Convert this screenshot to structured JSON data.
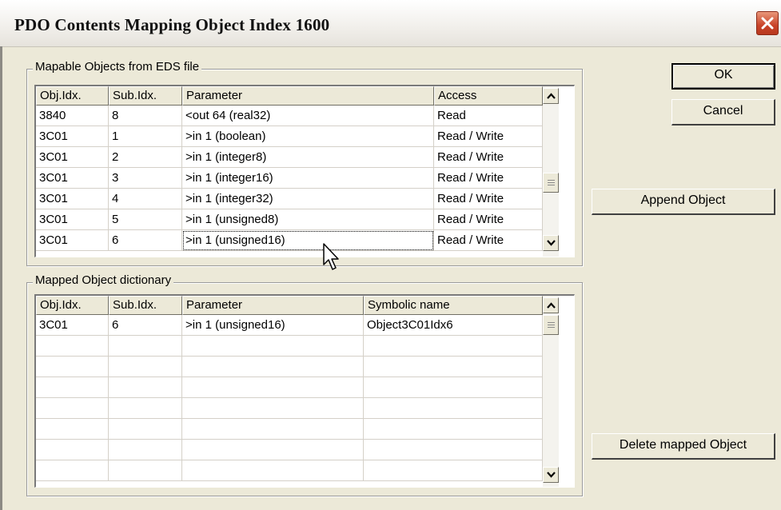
{
  "dialog": {
    "title": "PDO Contents Mapping Object Index 1600"
  },
  "mapable": {
    "group_label": "Mapable Objects from EDS file",
    "columns": [
      "Obj.Idx.",
      "Sub.Idx.",
      "Parameter",
      "Access"
    ],
    "rows": [
      [
        "3840",
        "8",
        "<out 64 (real32)",
        "Read"
      ],
      [
        "3C01",
        "1",
        ">in 1 (boolean)",
        "Read / Write"
      ],
      [
        "3C01",
        "2",
        ">in 1 (integer8)",
        "Read / Write"
      ],
      [
        "3C01",
        "3",
        ">in 1 (integer16)",
        "Read / Write"
      ],
      [
        "3C01",
        "4",
        ">in 1 (integer32)",
        "Read / Write"
      ],
      [
        "3C01",
        "5",
        ">in 1 (unsigned8)",
        "Read / Write"
      ],
      [
        "3C01",
        "6",
        ">in 1 (unsigned16)",
        "Read / Write"
      ]
    ],
    "focused_row": 6
  },
  "mapped": {
    "group_label": "Mapped Object dictionary",
    "columns": [
      "Obj.Idx.",
      "Sub.Idx.",
      "Parameter",
      "Symbolic name"
    ],
    "rows": [
      [
        "3C01",
        "6",
        ">in 1 (unsigned16)",
        "Object3C01Idx6"
      ],
      [
        "",
        "",
        "",
        ""
      ],
      [
        "",
        "",
        "",
        ""
      ],
      [
        "",
        "",
        "",
        ""
      ],
      [
        "",
        "",
        "",
        ""
      ],
      [
        "",
        "",
        "",
        ""
      ],
      [
        "",
        "",
        "",
        ""
      ],
      [
        "",
        "",
        "",
        ""
      ]
    ]
  },
  "buttons": {
    "ok": "OK",
    "cancel": "Cancel",
    "append": "Append Object",
    "delete": "Delete mapped Object"
  },
  "icons": {
    "close": "close-icon",
    "scroll_up": "arrow-up-icon",
    "scroll_down": "arrow-down-icon",
    "cursor": "mouse-pointer-icon"
  }
}
